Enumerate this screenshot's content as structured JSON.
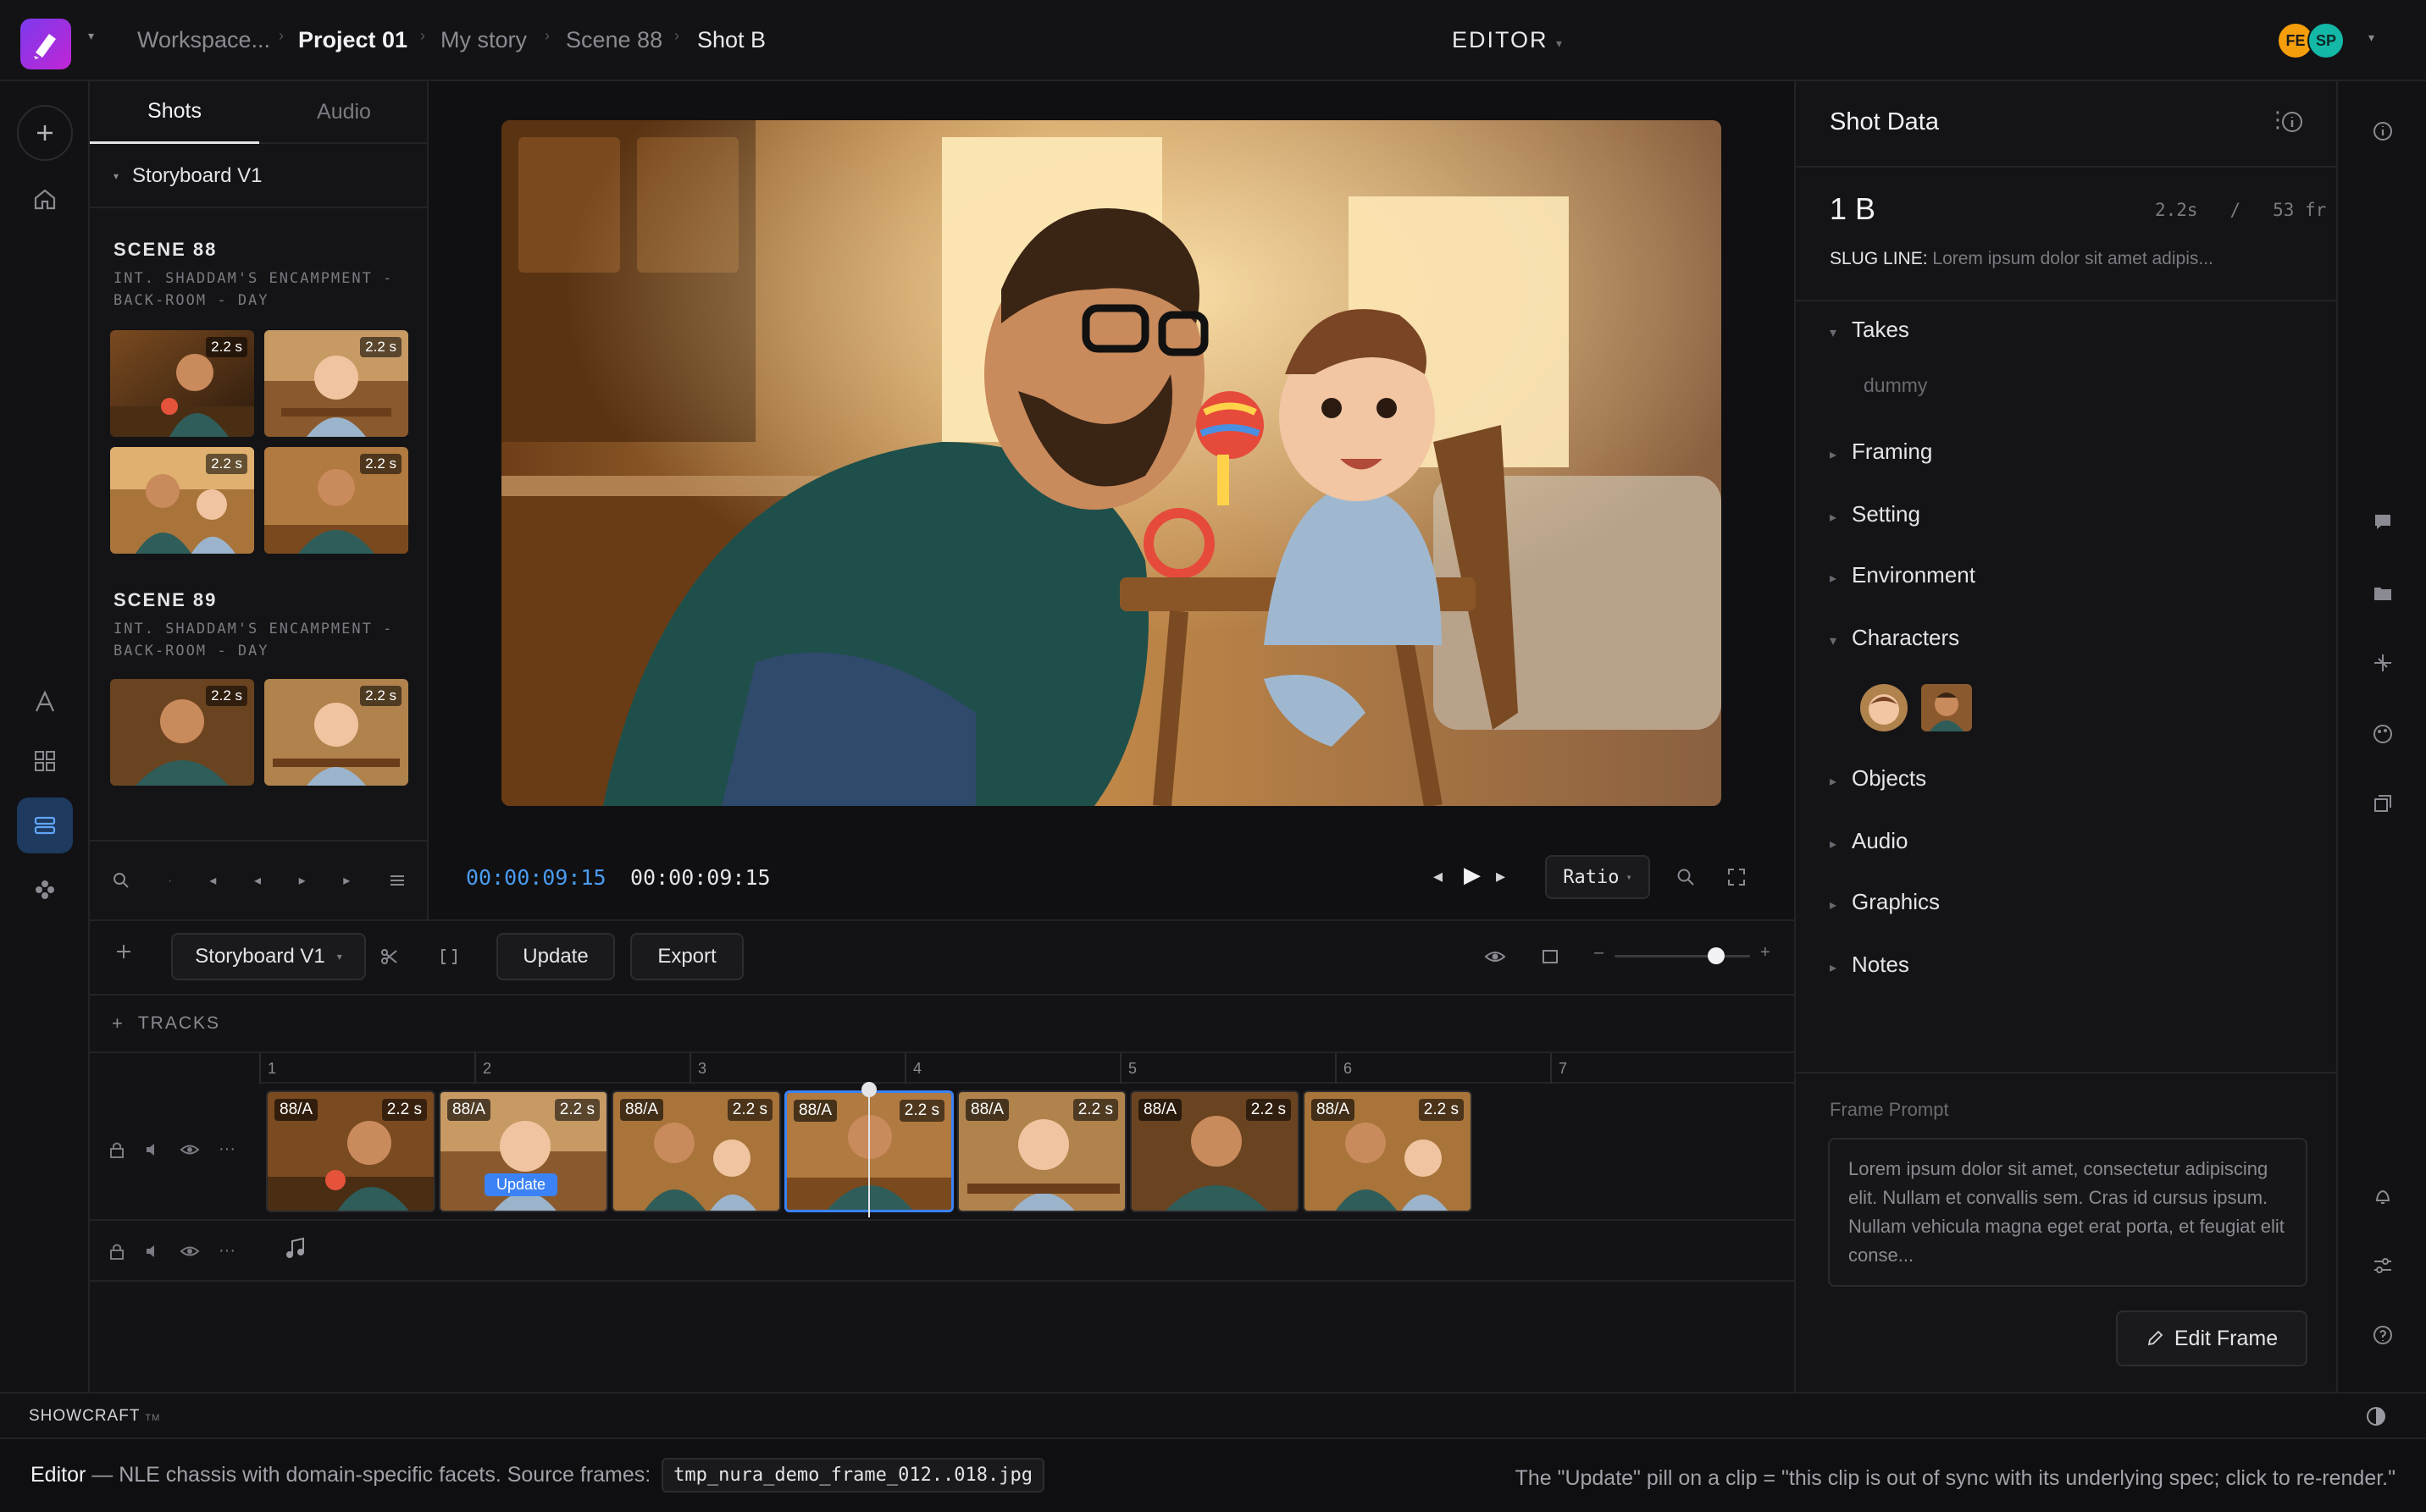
{
  "header": {
    "breadcrumb": [
      "Workspace...",
      "Project 01",
      "My story",
      "Scene 88",
      "Shot B"
    ],
    "mode_title": "EDITOR",
    "avatars": [
      "FE",
      "SP"
    ],
    "colors": {
      "avatar_fe": "#f59e0b",
      "avatar_sp": "#14b8a6",
      "brand": "#8b5cf6"
    }
  },
  "shots_panel": {
    "tabs": [
      "Shots",
      "Audio"
    ],
    "active_tab": "Shots",
    "storyboard": "Storyboard V1",
    "scenes": [
      {
        "title": "SCENE 88",
        "slug": "INT. SHADDAM'S ENCAMPMENT - BACK-ROOM - DAY",
        "shots": [
          "2.2 s",
          "2.2 s",
          "2.2 s",
          "2.2 s"
        ]
      },
      {
        "title": "SCENE 89",
        "slug": "INT. SHADDAM'S ENCAMPMENT - BACK-ROOM - DAY",
        "shots": [
          "2.2 s",
          "2.2 s"
        ]
      }
    ]
  },
  "viewer": {
    "timecode_current": "00:00:09:15",
    "timecode_total": "00:00:09:15",
    "ratio_label": "Ratio"
  },
  "shot_data": {
    "title": "Shot Data",
    "shot_id": "1 B",
    "duration": "2.2s",
    "separator": "/",
    "frames": "53 fr",
    "slug_label": "SLUG LINE:",
    "slug_value": "Lorem ipsum dolor sit amet adipis...",
    "sections": {
      "takes": "Takes",
      "takes_item": "dummy",
      "framing": "Framing",
      "setting": "Setting",
      "environment": "Environment",
      "characters": "Characters",
      "objects": "Objects",
      "audio": "Audio",
      "graphics": "Graphics",
      "notes": "Notes"
    },
    "frame_prompt_label": "Frame Prompt",
    "frame_prompt": "Lorem ipsum dolor sit amet, consectetur adipiscing elit. Nullam et convallis sem. Cras id cursus ipsum. Nullam vehicula magna eget erat porta, et feugiat elit conse...",
    "edit_frame_label": "Edit Frame"
  },
  "timeline": {
    "storyboard_select": "Storyboard V1",
    "update_label": "Update",
    "export_label": "Export",
    "tracks_label": "TRACKS",
    "zoom_level": 0.75,
    "ruler": [
      "1",
      "2",
      "3",
      "4",
      "5",
      "6",
      "7"
    ],
    "clips": [
      {
        "label": "88/A",
        "dur": "2.2 s"
      },
      {
        "label": "88/A",
        "dur": "2.2 s",
        "badge": "Update"
      },
      {
        "label": "88/A",
        "dur": "2.2 s"
      },
      {
        "label": "88/A",
        "dur": "2.2 s",
        "selected": true
      },
      {
        "label": "88/A",
        "dur": "2.2 s"
      },
      {
        "label": "88/A",
        "dur": "2.2 s"
      },
      {
        "label": "88/A",
        "dur": "2.2 s"
      }
    ]
  },
  "brand_bar": {
    "brand": "SHOWCRAFT",
    "tm": "TM"
  },
  "note_bar": {
    "lead": "Editor",
    "text": " — NLE chassis with domain-specific facets. Source frames: ",
    "code": "tmp_nura_demo_frame_012..018.jpg",
    "right": "The \"Update\" pill on a clip = \"this clip is out of sync with its underlying spec; click to re-render.\""
  }
}
